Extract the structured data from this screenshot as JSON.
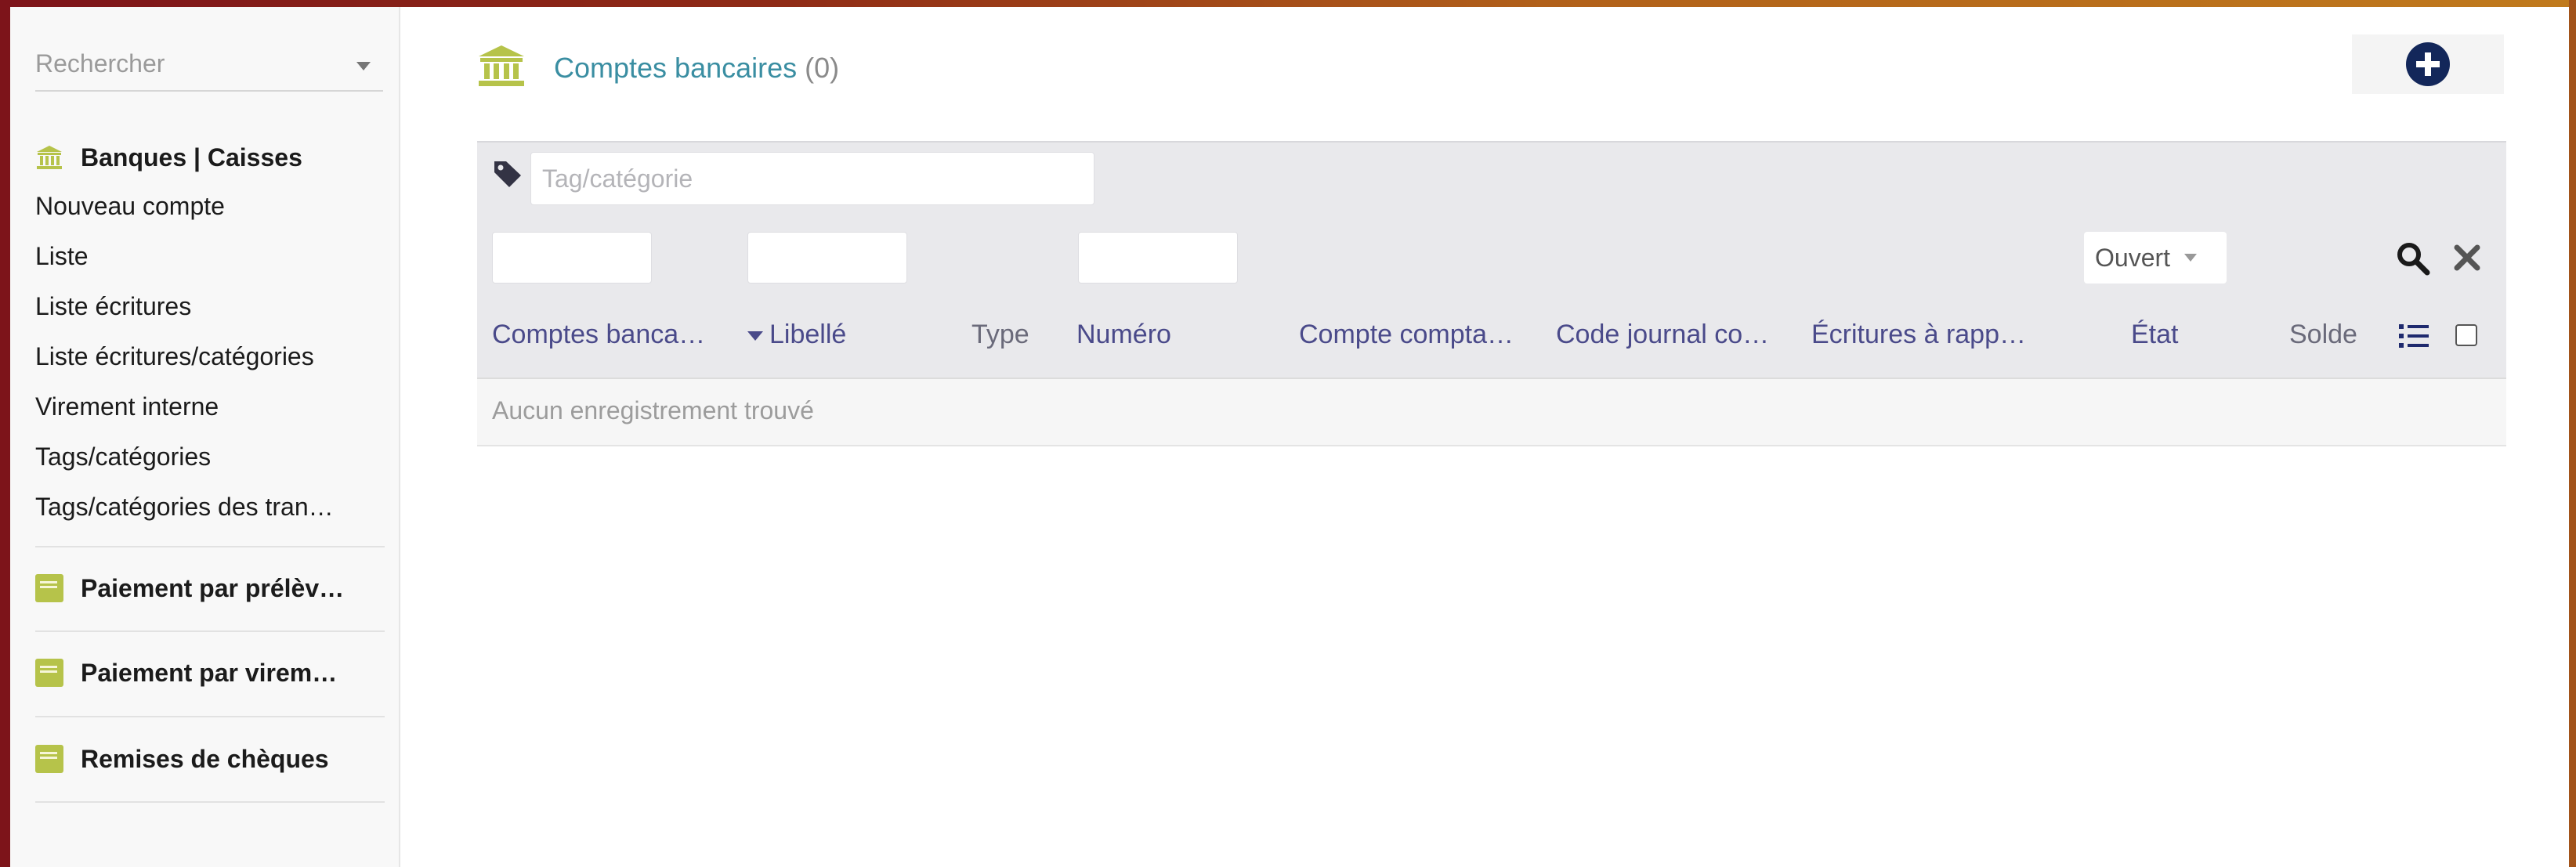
{
  "colors": {
    "frame": "#7d141a",
    "title": "#3a8ea2",
    "column_header": "#4a4a8a",
    "icon_accent": "#b6c34a",
    "add_button": "#13275a"
  },
  "sidebar": {
    "search_placeholder": "Rechercher",
    "sections": [
      {
        "title": "Banques | Caisses",
        "icon": "bank-icon",
        "items": [
          "Nouveau compte",
          "Liste",
          "Liste écritures",
          "Liste écritures/catégories",
          "Virement interne",
          "Tags/catégories",
          "Tags/catégories des tran…"
        ]
      },
      {
        "title": "Paiement par prélèv…",
        "icon": "card-icon"
      },
      {
        "title": "Paiement par virem…",
        "icon": "card-icon"
      },
      {
        "title": "Remises de chèques",
        "icon": "card-icon"
      }
    ]
  },
  "header": {
    "title": "Comptes bancaires",
    "count": "(0)",
    "add_icon": "plus-circle-icon"
  },
  "filters": {
    "tag_placeholder": "Tag/catégorie",
    "state_value": "Ouvert",
    "search_icon": "search-icon",
    "clear_icon": "close-icon"
  },
  "table": {
    "columns": [
      "Comptes banca…",
      "Libellé",
      "Type",
      "Numéro",
      "Compte compta…",
      "Code journal co…",
      "Écritures à rapp…",
      "État",
      "Solde"
    ],
    "empty_message": "Aucun enregistrement trouvé"
  }
}
